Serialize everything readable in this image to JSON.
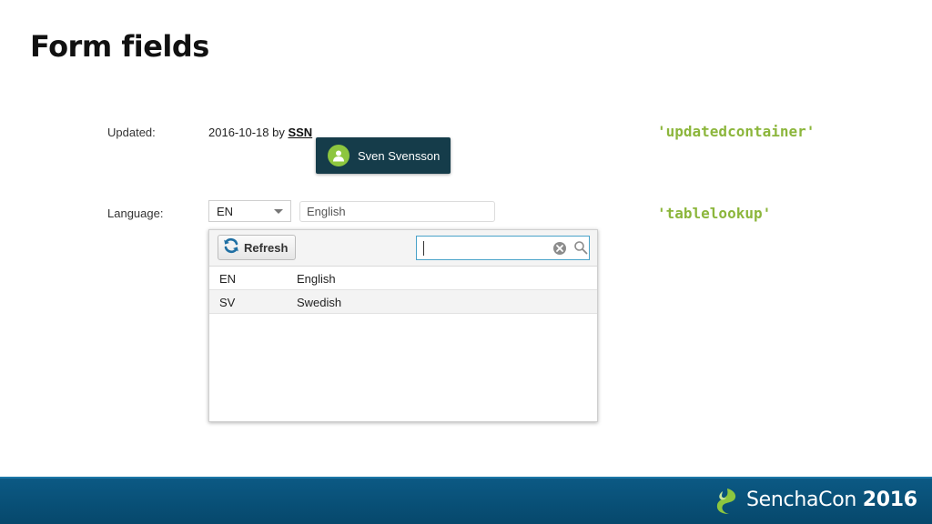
{
  "slide": {
    "title": "Form fields"
  },
  "updated": {
    "label": "Updated:",
    "date_by": "2016-10-18 by ",
    "user": "SSN",
    "tooltip_name": "Sven Svensson"
  },
  "language": {
    "label": "Language:",
    "combo_value": "EN",
    "display_value": "English"
  },
  "code_labels": {
    "updated": "'updatedcontainer'",
    "lookup": "'tablelookup'"
  },
  "lookup": {
    "refresh_label": "Refresh",
    "search_value": "",
    "rows": [
      {
        "code": "EN",
        "name": "English"
      },
      {
        "code": "SV",
        "name": "Swedish"
      }
    ]
  },
  "footer": {
    "brand": "SenchaCon",
    "year": "2016"
  },
  "colors": {
    "tooltip_bg": "#153c4a",
    "avatar": "#8dc63f",
    "code_text": "#8cb63c",
    "search_border": "#4aa3c9",
    "footer_bg": "#06486c"
  },
  "icons": [
    "user-icon",
    "refresh-icon",
    "clear-icon",
    "search-icon",
    "chevron-down-icon",
    "sencha-logo-icon"
  ]
}
